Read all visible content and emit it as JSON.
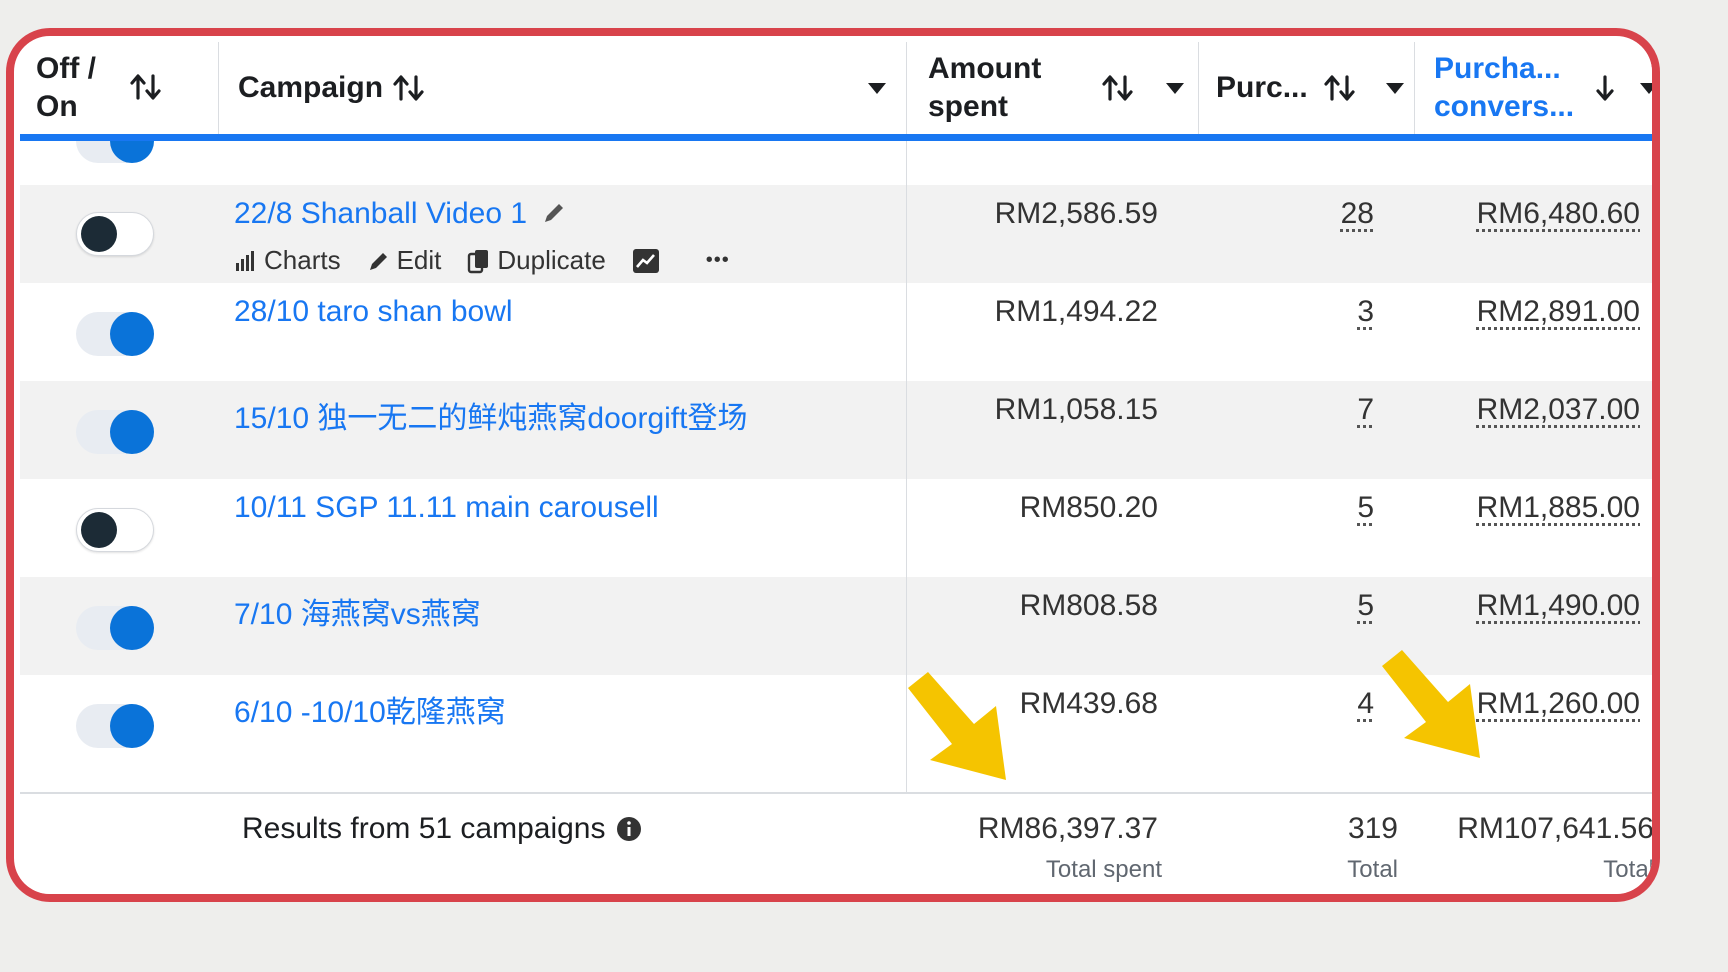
{
  "header": {
    "toggle_col": "Off / On",
    "campaign_col": "Campaign",
    "amount_col": "Amount spent",
    "purchases_col": "Purc...",
    "conversion_col_line1": "Purcha...",
    "conversion_col_line2": "convers..."
  },
  "actions": {
    "charts": "Charts",
    "edit": "Edit",
    "duplicate": "Duplicate",
    "more": "•••"
  },
  "rows": [
    {
      "name": "22/8 Shanball Video 1",
      "on": false,
      "amount": "RM2,586.59",
      "purchases": "28",
      "value": "RM6,480.60"
    },
    {
      "name": "28/10 taro shan bowl",
      "on": true,
      "amount": "RM1,494.22",
      "purchases": "3",
      "value": "RM2,891.00"
    },
    {
      "name": "15/10 独一无二的鲜炖燕窝doorgift登场",
      "on": true,
      "amount": "RM1,058.15",
      "purchases": "7",
      "value": "RM2,037.00"
    },
    {
      "name": "10/11 SGP 11.11 main carousell",
      "on": false,
      "amount": "RM850.20",
      "purchases": "5",
      "value": "RM1,885.00"
    },
    {
      "name": "7/10 海燕窝vs燕窝",
      "on": true,
      "amount": "RM808.58",
      "purchases": "5",
      "value": "RM1,490.00"
    },
    {
      "name": "6/10 -10/10乾隆燕窝",
      "on": true,
      "amount": "RM439.68",
      "purchases": "4",
      "value": "RM1,260.00"
    }
  ],
  "footer": {
    "results_label": "Results from 51 campaigns",
    "total_spent": "RM86,397.37",
    "total_spent_label": "Total spent",
    "total_purchases": "319",
    "total_purchases_label": "Total",
    "total_value": "RM107,641.56",
    "total_value_label": "Total"
  },
  "colors": {
    "frame": "#d8434b",
    "link": "#1877f2",
    "toggle_on": "#0a73d9",
    "arrow": "#f5c400"
  }
}
